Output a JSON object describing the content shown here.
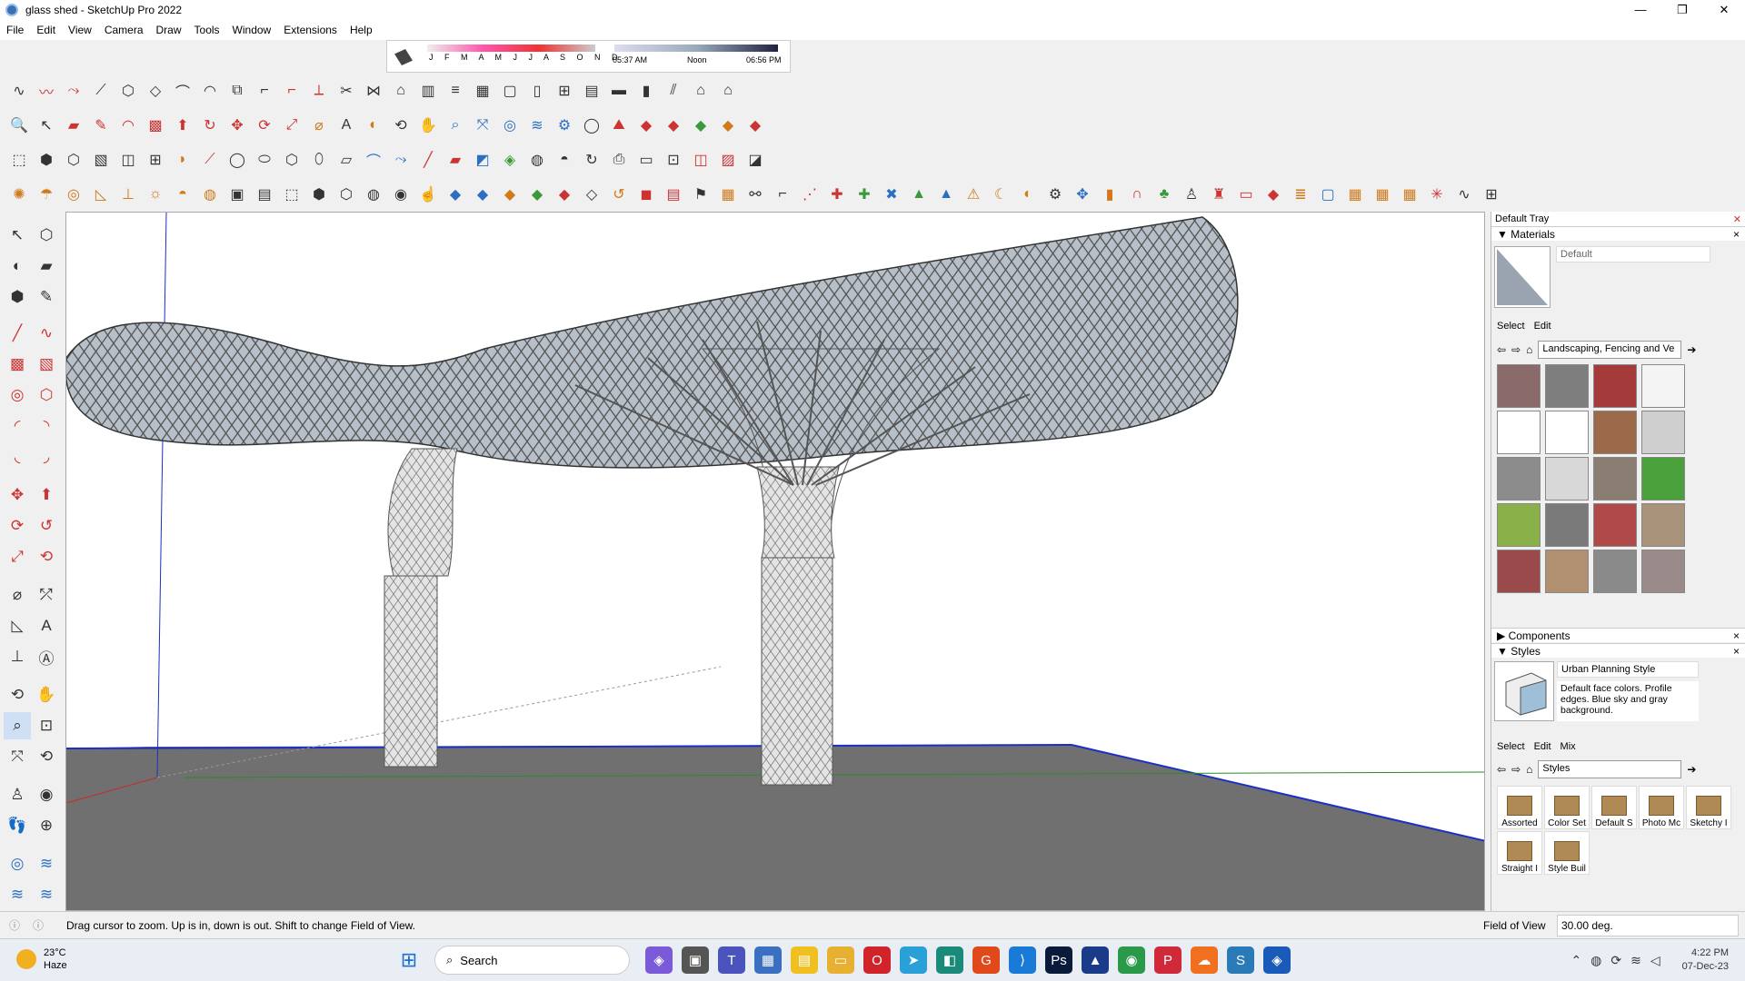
{
  "window": {
    "title": "glass shed - SketchUp Pro 2022",
    "minimize": "—",
    "maximize": "❐",
    "close": "✕"
  },
  "menu": [
    "File",
    "Edit",
    "View",
    "Camera",
    "Draw",
    "Tools",
    "Window",
    "Extensions",
    "Help"
  ],
  "shadow_bar": {
    "months": "J F M A M J J A S O N D",
    "time_start": "05:37 AM",
    "time_mid": "Noon",
    "time_end": "06:56 PM"
  },
  "tray": {
    "title": "Default Tray",
    "materials": {
      "section": "Materials",
      "current": "Default",
      "tab_select": "Select",
      "tab_edit": "Edit",
      "collection": "Landscaping, Fencing and Ve",
      "swatch_colors": [
        "#8a6a6a",
        "#7e7e7e",
        "#a43a3a",
        "#f4f4f4",
        "#ffffff",
        "#ffffff",
        "#9c6a4a",
        "#cfcfcf",
        "#8c8c8c",
        "#d8d8d8",
        "#8a7e72",
        "#4aa03a",
        "#8ab04a",
        "#7a7a7a",
        "#b04a4a",
        "#a8927a",
        "#9a4a4a",
        "#b09070",
        "#8a8a8a",
        "#9a8a8a"
      ]
    },
    "components": {
      "section": "Components"
    },
    "styles": {
      "section": "Styles",
      "current": "Urban Planning Style",
      "description": "Default face colors. Profile edges. Blue sky and gray background.",
      "tab_select": "Select",
      "tab_edit": "Edit",
      "tab_mix": "Mix",
      "collection": "Styles",
      "items": [
        "Assorted",
        "Color Set",
        "Default S",
        "Photo Mc",
        "Sketchy I",
        "Straight I",
        "Style Buil"
      ]
    }
  },
  "status": {
    "message": "Drag cursor to zoom.  Up is in, down is out. Shift to change Field of View.",
    "fov_label": "Field of View",
    "fov_value": "30.00 deg."
  },
  "taskbar": {
    "temp": "23°C",
    "condition": "Haze",
    "search": "Search",
    "time": "4:22 PM",
    "date": "07-Dec-23"
  }
}
